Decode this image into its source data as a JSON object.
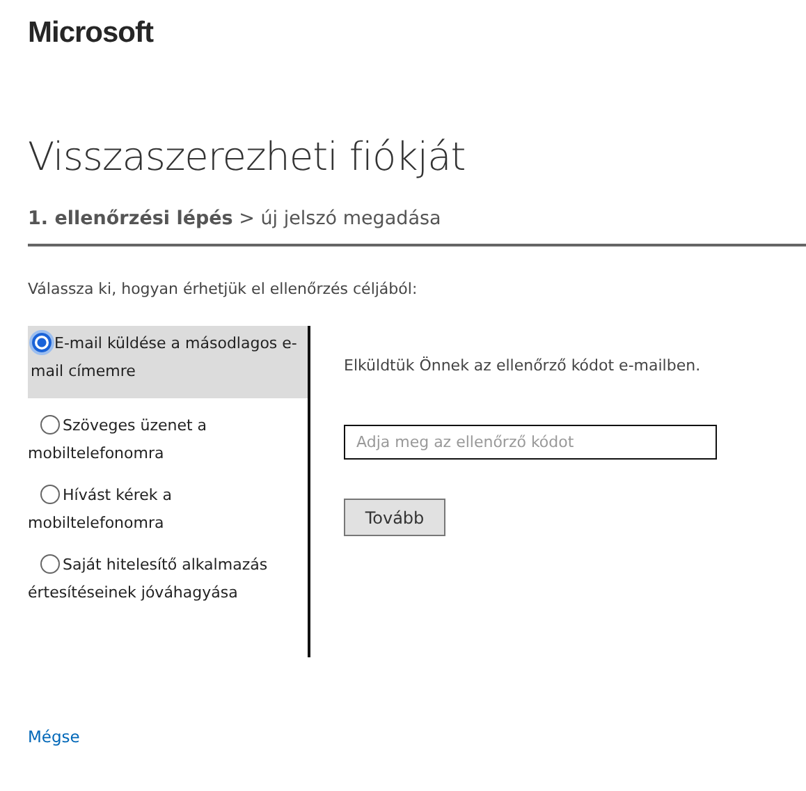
{
  "brand": "Microsoft",
  "title": "Visszaszerezheti fiókját",
  "breadcrumb": "**1. ellenőrzési lépés** > új jelszó megadása",
  "instruction": "Válassza ki, hogyan érhetjük el ellenőrzés céljából:",
  "options": [
    {
      "label": "E-mail küldése a másodlagos e-mail címemre",
      "selected": true
    },
    {
      "label": "Szöveges üzenet a mobiltelefonomra",
      "selected": false
    },
    {
      "label": "Hívást kérek a mobiltelefonomra",
      "selected": false
    },
    {
      "label": "Saját hitelesítő alkalmazás értesítéseinek jóváhagyása",
      "selected": false
    }
  ],
  "message": "Elküldtük Önnek az ellenőrző kódot e-mailben.",
  "code_field": {
    "placeholder": "Adja meg az ellenőrző kódot"
  },
  "next_button": "Tovább",
  "cancel_link": "Mégse"
}
